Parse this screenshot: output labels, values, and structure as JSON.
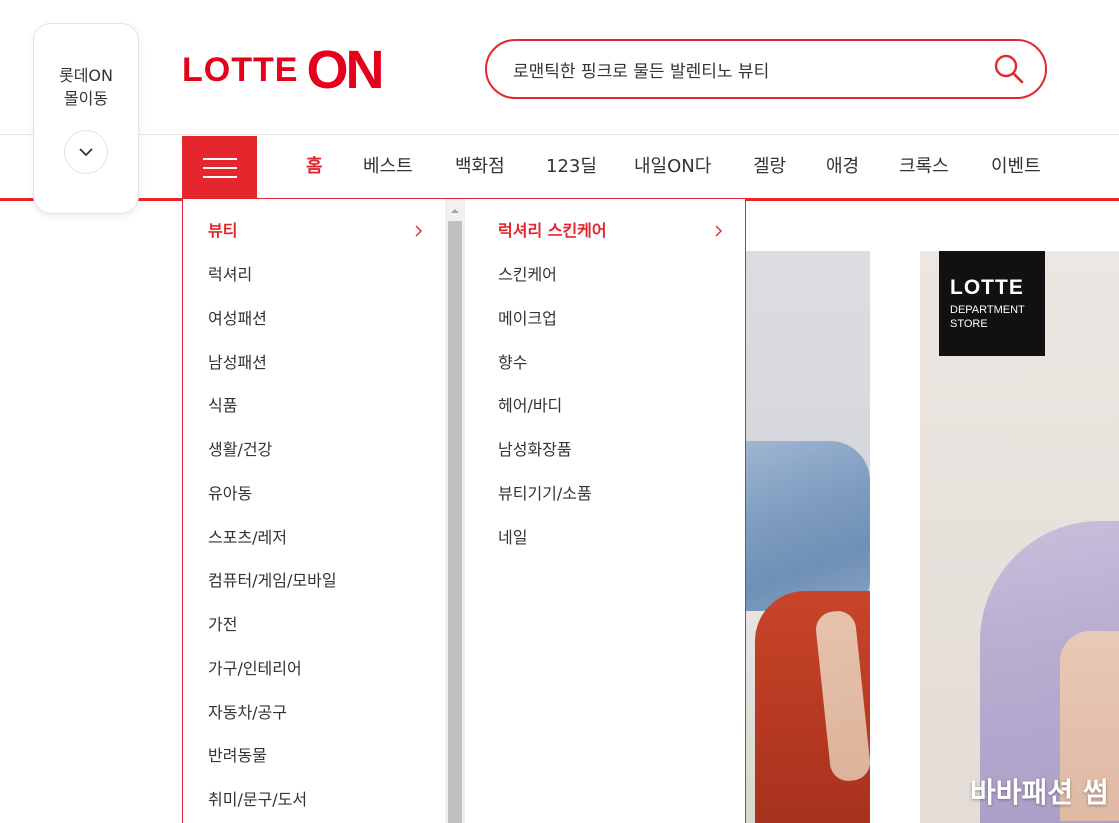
{
  "mall_widget": {
    "line1": "롯데ON",
    "line2": "몰이동",
    "toggle_icon": "chevron-down-icon"
  },
  "logo": {
    "part1": "LOTTE",
    "part2": "ON",
    "brand_color": "#e5001c"
  },
  "search": {
    "value": "로맨틱한 핑크로 물든 발렌티노 뷰티",
    "placeholder": "",
    "icon": "search-icon"
  },
  "gnb": {
    "menu_icon": "hamburger-icon",
    "items": [
      {
        "label": "홈",
        "active": true
      },
      {
        "label": "베스트"
      },
      {
        "label": "백화점"
      },
      {
        "label": "123딜"
      },
      {
        "label": "내일ON다"
      },
      {
        "label": "겔랑"
      },
      {
        "label": "애경"
      },
      {
        "label": "크록스"
      },
      {
        "label": "이벤트"
      }
    ],
    "accent_color": "#e5262d"
  },
  "categories": {
    "primary": [
      {
        "label": "뷰티",
        "active": true
      },
      {
        "label": "럭셔리"
      },
      {
        "label": "여성패션"
      },
      {
        "label": "남성패션"
      },
      {
        "label": "식품"
      },
      {
        "label": "생활/건강"
      },
      {
        "label": "유아동"
      },
      {
        "label": "스포츠/레저"
      },
      {
        "label": "컴퓨터/게임/모바일"
      },
      {
        "label": "가전"
      },
      {
        "label": "가구/인테리어"
      },
      {
        "label": "자동차/공구"
      },
      {
        "label": "반려동물"
      },
      {
        "label": "취미/문구/도서"
      }
    ],
    "secondary": [
      {
        "label": "럭셔리 스킨케어",
        "active": true
      },
      {
        "label": "스킨케어"
      },
      {
        "label": "메이크업"
      },
      {
        "label": "향수"
      },
      {
        "label": "헤어/바디"
      },
      {
        "label": "남성화장품"
      },
      {
        "label": "뷰티기기/소품"
      },
      {
        "label": "네일"
      }
    ]
  },
  "banner2": {
    "badge_line1": "LOTTE",
    "badge_line2": "DEPARTMENT",
    "badge_line3": "STORE",
    "caption": "바바패션 썸"
  }
}
